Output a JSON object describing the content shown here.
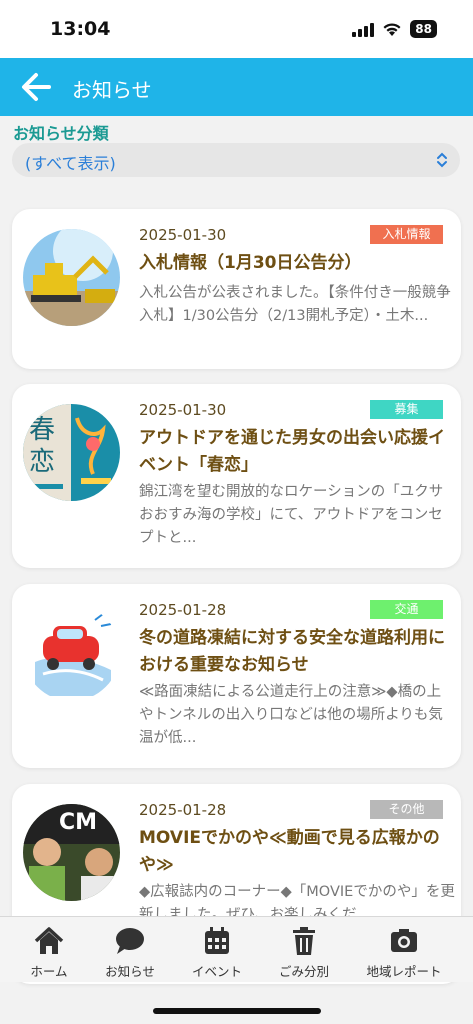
{
  "status": {
    "time": "13:04",
    "battery": "88"
  },
  "appbar": {
    "title": "お知らせ"
  },
  "filter": {
    "label": "お知らせ分類",
    "selected": "(すべて表示)"
  },
  "news": [
    {
      "date": "2025-01-30",
      "badge": "入札情報",
      "badge_color": "#f07050",
      "title": "入札情報（1月30日公告分）",
      "excerpt": "入札公告が公表されました。【条件付き一般競争入札】1/30公告分（2/13開札予定）・土木..."
    },
    {
      "date": "2025-01-30",
      "badge": "募集",
      "badge_color": "#3fd6c4",
      "title": "アウトドアを通じた男女の出会い応援イベント「春恋」",
      "excerpt": "錦江湾を望む開放的なロケーションの「ユクサおおすみ海の学校」にて、アウトドアをコンセプトと...",
      "thumb_text": "春恋"
    },
    {
      "date": "2025-01-28",
      "badge": "交通",
      "badge_color": "#6ef06e",
      "title": "冬の道路凍結に対する安全な道路利用における重要なお知らせ",
      "excerpt": "≪路面凍結による公道走行上の注意≫◆橋の上やトンネルの出入り口などは他の場所よりも気温が低..."
    },
    {
      "date": "2025-01-28",
      "badge": "その他",
      "badge_color": "#b8b8b8",
      "title": "MOVIEでかのや≪動画で見る広報かのや≫",
      "excerpt": "◆広報誌内のコーナー◆「MOVIEでかのや」を更新しました。ぜひ、お楽しみくだ",
      "thumb_text": "CM"
    }
  ],
  "tabs": [
    {
      "label": "ホーム",
      "icon": "home-icon"
    },
    {
      "label": "お知らせ",
      "icon": "chat-bubble-icon"
    },
    {
      "label": "イベント",
      "icon": "calendar-icon"
    },
    {
      "label": "ごみ分別",
      "icon": "trash-icon"
    },
    {
      "label": "地域レポート",
      "icon": "camera-icon"
    }
  ]
}
